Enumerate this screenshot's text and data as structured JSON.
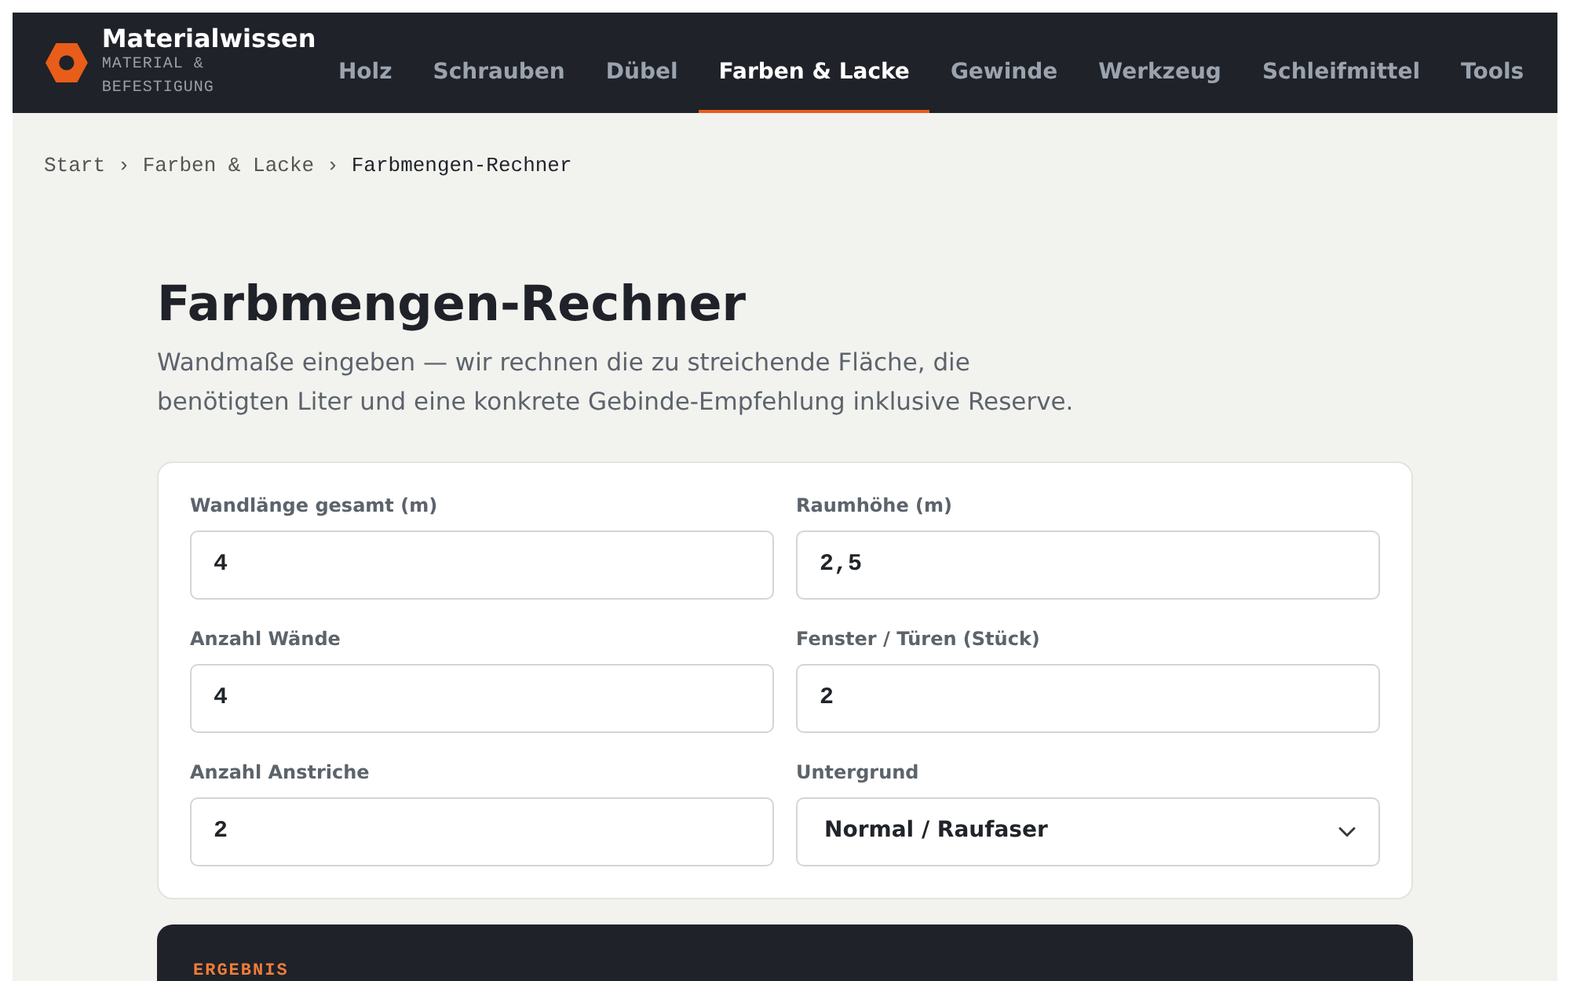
{
  "brand": {
    "name": "Materialwissen",
    "tagline": "MATERIAL & BEFESTIGUNG"
  },
  "nav": [
    {
      "label": "Holz",
      "selected": false
    },
    {
      "label": "Schrauben",
      "selected": false
    },
    {
      "label": "Dübel",
      "selected": false
    },
    {
      "label": "Farben & Lacke",
      "selected": true
    },
    {
      "label": "Gewinde",
      "selected": false
    },
    {
      "label": "Werkzeug",
      "selected": false
    },
    {
      "label": "Schleifmittel",
      "selected": false
    },
    {
      "label": "Tools",
      "selected": false
    }
  ],
  "breadcrumb": [
    {
      "label": "Start",
      "separator": "›"
    },
    {
      "label": "Farben & Lacke",
      "separator": "›"
    },
    {
      "label": "Farbmengen-Rechner"
    }
  ],
  "title": "Farbmengen-Rechner",
  "intro": "Wandmaße eingeben — wir rechnen die zu streichende Fläche, die benötigten Liter und eine konkrete Gebinde-Empfehlung inklusive Reserve.",
  "fields": [
    {
      "label": "Wandlänge gesamt (m)",
      "kind": "input",
      "value": "4"
    },
    {
      "label": "Raumhöhe (m)",
      "kind": "input",
      "value": "2,5"
    },
    {
      "label": "Anzahl Wände",
      "kind": "input",
      "value": "4"
    },
    {
      "label": "Fenster / Türen (Stück)",
      "kind": "input",
      "value": "2"
    },
    {
      "label": "Anzahl Anstriche",
      "kind": "input",
      "value": "2"
    },
    {
      "label": "Untergrund",
      "kind": "select",
      "value": "Normal / Raufaser"
    }
  ],
  "result": {
    "heading": "ERGEBNIS"
  }
}
